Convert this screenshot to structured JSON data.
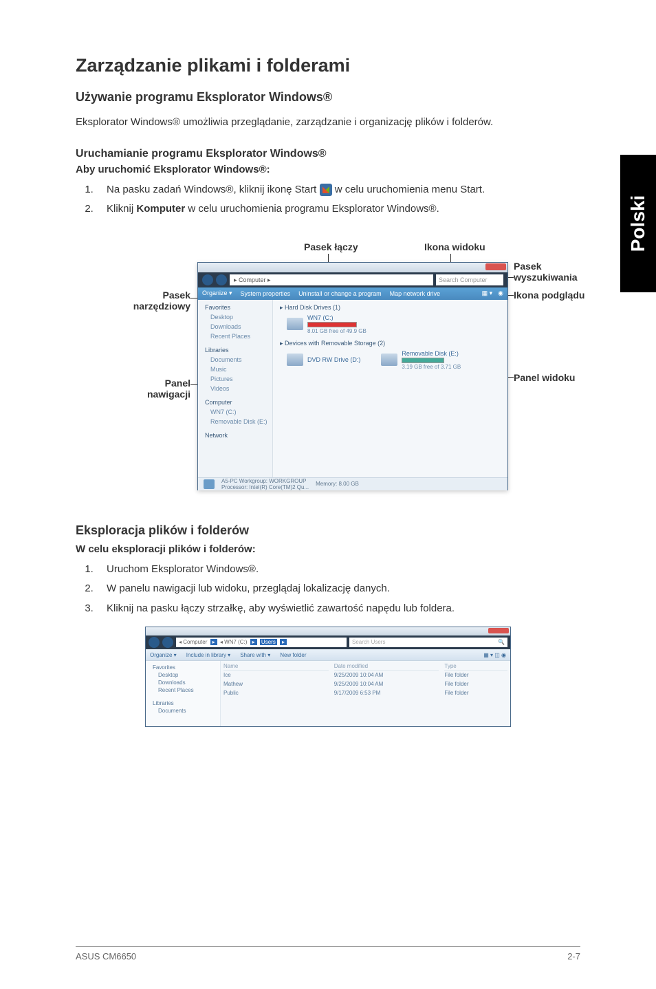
{
  "page": {
    "lang_tab": "Polski",
    "title": "Zarządzanie plikami i folderami"
  },
  "sec1": {
    "heading": "Używanie programu Eksplorator Windows®",
    "intro": "Eksplorator Windows® umożliwia przeglądanie, zarządzanie i organizację plików i folderów."
  },
  "sec2": {
    "heading": "Uruchamianie programu Eksplorator Windows®",
    "sub": "Aby uruchomić Eksplorator Windows®:",
    "step1_pre": "Na pasku zadań Windows®, kliknij ikonę Start ",
    "step1_post": " w celu uruchomienia menu Start.",
    "step2_pre": "Kliknij ",
    "step2_bold": "Komputer",
    "step2_post": " w celu uruchomienia programu Eksplorator Windows®."
  },
  "fig1": {
    "labels": {
      "pasek_laczy": "Pasek łączy",
      "ikona_widoku": "Ikona widoku",
      "pasek_narz": "Pasek narzędziowy",
      "pasek_wysz": "Pasek wyszukiwania",
      "ikona_podgladu": "Ikona podglądu",
      "panel_nawigacji": "Panel nawigacji",
      "panel_widoku": "Panel widoku"
    },
    "window": {
      "breadcrumb": "▸ Computer ▸",
      "search": "Search Computer",
      "toolbar": {
        "organize": "Organize ▾",
        "props": "System properties",
        "uninstall": "Uninstall or change a program",
        "map": "Map network drive",
        "view_icon": "▦ ▾",
        "help_icon": "◉"
      },
      "nav": {
        "favorites": "Favorites",
        "desktop": "Desktop",
        "downloads": "Downloads",
        "recent": "Recent Places",
        "libraries": "Libraries",
        "documents": "Documents",
        "music": "Music",
        "pictures": "Pictures",
        "videos": "Videos",
        "computer": "Computer",
        "wn7c": "WN7 (C:)",
        "removable": "Removable Disk (E:)",
        "network": "Network"
      },
      "content": {
        "hdd_group": "▸ Hard Disk Drives (1)",
        "hdd_name": "WN7 (C:)",
        "hdd_detail": "8.01 GB free of 49.9 GB",
        "rem_group": "▸ Devices with Removable Storage (2)",
        "dvd_name": "DVD RW Drive (D:)",
        "rem_name": "Removable Disk (E:)",
        "rem_detail": "3.19 GB free of 3.71 GB"
      },
      "status": {
        "workgroup": "A5-PC Workgroup: WORKGROUP",
        "memory": "Memory: 8.00 GB",
        "processor": "Processor: Intel(R) Core(TM)2 Qu..."
      }
    }
  },
  "sec3": {
    "heading": "Eksploracja plików i folderów",
    "sub": "W celu eksploracji plików i folderów:",
    "step1": "Uruchom Eksplorator Windows®.",
    "step2": "W panelu nawigacji lub widoku, przeglądaj lokalizację danych.",
    "step3": "Kliknij na pasku łączy strzałkę, aby wyświetlić zawartość napędu lub foldera."
  },
  "fig2": {
    "breadcrumb": {
      "c": "◂ Computer",
      "d": "◂ WN7 (C:)",
      "u": "Users",
      "arr": "▸"
    },
    "search_placeholder": "Search Users",
    "toolbar": {
      "organize": "Organize ▾",
      "include": "Include in library ▾",
      "share": "Share with ▾",
      "new_folder": "New folder",
      "right": "▦ ▾   ◫   ◉"
    },
    "nav": {
      "favorites": "Favorites",
      "desktop": "Desktop",
      "downloads": "Downloads",
      "recent": "Recent Places",
      "libraries": "Libraries",
      "documents": "Documents"
    },
    "cols": {
      "name_hd": "Name",
      "date_hd": "Date modified",
      "type_hd": "Type",
      "rows": [
        {
          "name": "Ice",
          "date": "9/25/2009 10:04 AM",
          "type": "File folder"
        },
        {
          "name": "Mathew",
          "date": "9/25/2009 10:04 AM",
          "type": "File folder"
        },
        {
          "name": "Public",
          "date": "9/17/2009 6:53 PM",
          "type": "File folder"
        }
      ]
    }
  },
  "footer": {
    "left": "ASUS CM6650",
    "right": "2-7"
  }
}
